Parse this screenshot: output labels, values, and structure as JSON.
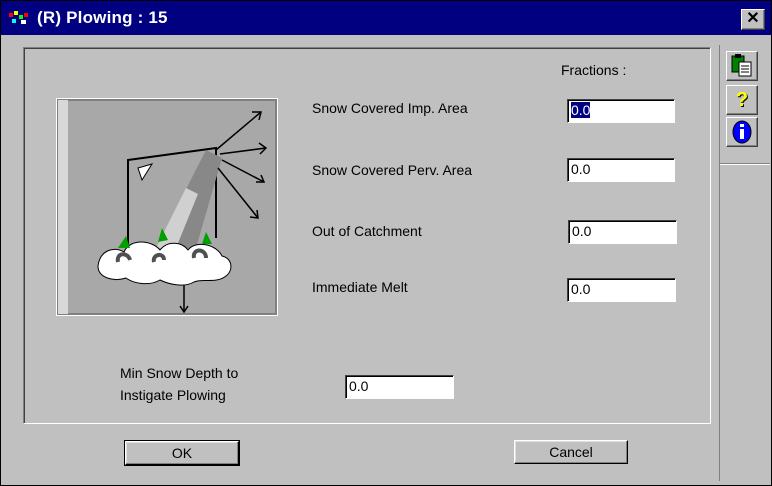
{
  "window": {
    "title": "(R) Plowing : 15"
  },
  "fractions_header": "Fractions :",
  "fields": [
    {
      "label": "Snow Covered Imp. Area",
      "value": "0.0"
    },
    {
      "label": "Snow Covered Perv. Area",
      "value": "0.0"
    },
    {
      "label": "Out of Catchment",
      "value": "0.0"
    },
    {
      "label": "Immediate Melt",
      "value": "0.0"
    }
  ],
  "min_depth": {
    "label_line1": "Min Snow Depth to",
    "label_line2": "Instigate Plowing",
    "value": "0.0"
  },
  "buttons": {
    "ok": "OK",
    "cancel": "Cancel"
  },
  "toolbar": {
    "icons": [
      "clipboard-icon",
      "help-icon",
      "info-icon"
    ],
    "help_glyph": "?",
    "info_glyph": "i"
  },
  "close_glyph": "✕",
  "colors": {
    "titlebar": "#000080",
    "face": "#c0c0c0",
    "help": "#ffff00",
    "info": "#0000ff"
  }
}
